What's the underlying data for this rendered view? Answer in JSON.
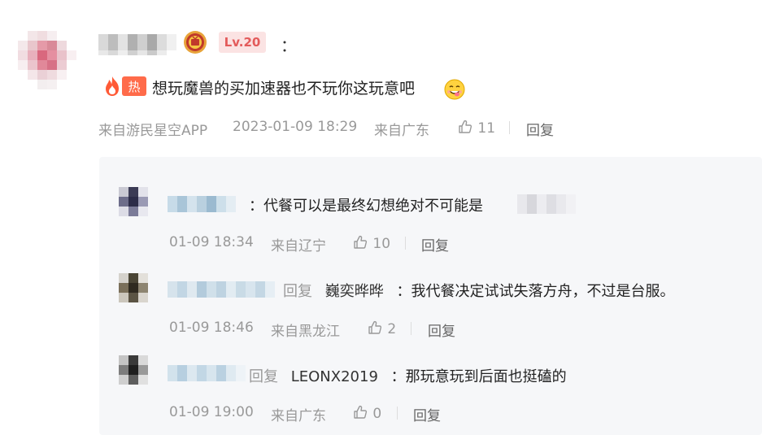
{
  "main_comment": {
    "level_badge": "Lv.20",
    "colon": "：",
    "hot_badge": "热",
    "text": "想玩魔兽的买加速器也不玩你这玩意吧",
    "source": "来自游民星空APP",
    "timestamp": "2023-01-09 18:29",
    "location": "来自广东",
    "likes": "11",
    "reply_label": "回复"
  },
  "replies": [
    {
      "text": "：代餐可以是最终幻想绝对不可能是",
      "reply_prefix": "",
      "target": "",
      "time": "01-09 18:34",
      "location": "来自辽宁",
      "likes": "10",
      "reply_label": "回复"
    },
    {
      "reply_prefix": "回复",
      "target": "巍奕晔晔",
      "text": "：我代餐决定试试失落方舟，不过是台服。",
      "time": "01-09 18:46",
      "location": "来自黑龙江",
      "likes": "2",
      "reply_label": "回复"
    },
    {
      "reply_prefix": "回复",
      "target": "LEONX2019",
      "text": "：那玩意玩到后面也挺磕的",
      "time": "01-09 19:00",
      "location": "来自广东",
      "likes": "0",
      "reply_label": "回复"
    }
  ],
  "icons": {
    "medal": "medal-icon",
    "hot": "fire-icon",
    "emoji": "yummy-face-emoji-icon",
    "like": "thumbs-up-icon"
  },
  "colors": {
    "hot_badge_bg": "#ff6b4a",
    "level_badge_bg": "#fbe3e3",
    "level_badge_text": "#e35b5b",
    "reply_panel_bg": "#f6f7f9",
    "meta_text": "#999999"
  }
}
